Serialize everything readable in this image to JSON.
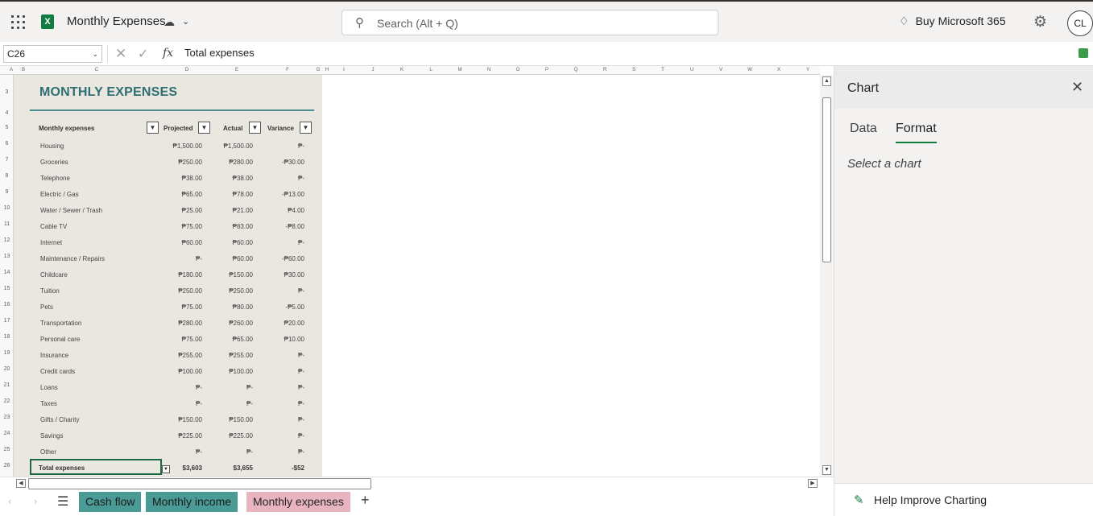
{
  "app": {
    "doc_title": "Monthly Expenses",
    "search_placeholder": "Search (Alt + Q)",
    "buy_label": "Buy Microsoft 365",
    "avatar_initials": "CL",
    "logo_letter": "X",
    "accent_color": "#107c41"
  },
  "formula_bar": {
    "name_box": "C26",
    "fx_label": "fx",
    "value": "Total expenses"
  },
  "grid": {
    "columns": [
      "A",
      "B",
      "C",
      "D",
      "E",
      "F",
      "G",
      "H",
      "I",
      "J",
      "K",
      "L",
      "M",
      "N",
      "O",
      "P",
      "Q",
      "R",
      "S",
      "T",
      "U",
      "V",
      "W",
      "X",
      "Y"
    ],
    "row_numbers": [
      "3",
      "4",
      "5",
      "6",
      "7",
      "8",
      "9",
      "10",
      "11",
      "12",
      "13",
      "14",
      "15",
      "16",
      "17",
      "18",
      "19",
      "20",
      "21",
      "22",
      "23",
      "24",
      "25",
      "26"
    ]
  },
  "sheet": {
    "title": "MONTHLY EXPENSES",
    "headers": {
      "category": "Monthly expenses",
      "projected": "Projected",
      "actual": "Actual",
      "variance": "Variance"
    },
    "rows": [
      {
        "label": "Housing",
        "projected": "₱1,500.00",
        "actual": "₱1,500.00",
        "variance": "₱-"
      },
      {
        "label": "Groceries",
        "projected": "₱250.00",
        "actual": "₱280.00",
        "variance": "-₱30.00"
      },
      {
        "label": "Telephone",
        "projected": "₱38.00",
        "actual": "₱38.00",
        "variance": "₱-"
      },
      {
        "label": "Electric / Gas",
        "projected": "₱65.00",
        "actual": "₱78.00",
        "variance": "-₱13.00"
      },
      {
        "label": "Water / Sewer / Trash",
        "projected": "₱25.00",
        "actual": "₱21.00",
        "variance": "₱4.00"
      },
      {
        "label": "Cable TV",
        "projected": "₱75.00",
        "actual": "₱83.00",
        "variance": "-₱8.00"
      },
      {
        "label": "Internet",
        "projected": "₱60.00",
        "actual": "₱60.00",
        "variance": "₱-"
      },
      {
        "label": "Maintenance / Repairs",
        "projected": "₱-",
        "actual": "₱60.00",
        "variance": "-₱60.00"
      },
      {
        "label": "Childcare",
        "projected": "₱180.00",
        "actual": "₱150.00",
        "variance": "₱30.00"
      },
      {
        "label": "Tuition",
        "projected": "₱250.00",
        "actual": "₱250.00",
        "variance": "₱-"
      },
      {
        "label": "Pets",
        "projected": "₱75.00",
        "actual": "₱80.00",
        "variance": "-₱5.00"
      },
      {
        "label": "Transportation",
        "projected": "₱280.00",
        "actual": "₱260.00",
        "variance": "₱20.00"
      },
      {
        "label": "Personal care",
        "projected": "₱75.00",
        "actual": "₱65.00",
        "variance": "₱10.00"
      },
      {
        "label": "Insurance",
        "projected": "₱255.00",
        "actual": "₱255.00",
        "variance": "₱-"
      },
      {
        "label": "Credit cards",
        "projected": "₱100.00",
        "actual": "₱100.00",
        "variance": "₱-"
      },
      {
        "label": "Loans",
        "projected": "₱-",
        "actual": "₱-",
        "variance": "₱-"
      },
      {
        "label": "Taxes",
        "projected": "₱-",
        "actual": "₱-",
        "variance": "₱-"
      },
      {
        "label": "Gifts / Charity",
        "projected": "₱150.00",
        "actual": "₱150.00",
        "variance": "₱-"
      },
      {
        "label": "Savings",
        "projected": "₱225.00",
        "actual": "₱225.00",
        "variance": "₱-"
      },
      {
        "label": "Other",
        "projected": "₱-",
        "actual": "₱-",
        "variance": "₱-"
      }
    ],
    "total": {
      "label": "Total expenses",
      "projected": "$3,603",
      "actual": "$3,655",
      "variance": "-$52"
    }
  },
  "tabs": [
    {
      "label": "Cash flow",
      "color": "#4a9b95",
      "active": false
    },
    {
      "label": "Monthly income",
      "color": "#4a9b95",
      "active": false
    },
    {
      "label": "Monthly expenses",
      "color": "#e8b4c0",
      "active": true
    }
  ],
  "side_panel": {
    "title": "Chart",
    "tabs": [
      "Data",
      "Format"
    ],
    "active_tab": "Format",
    "message": "Select a chart",
    "feedback_label": "Help Improve Charting"
  }
}
